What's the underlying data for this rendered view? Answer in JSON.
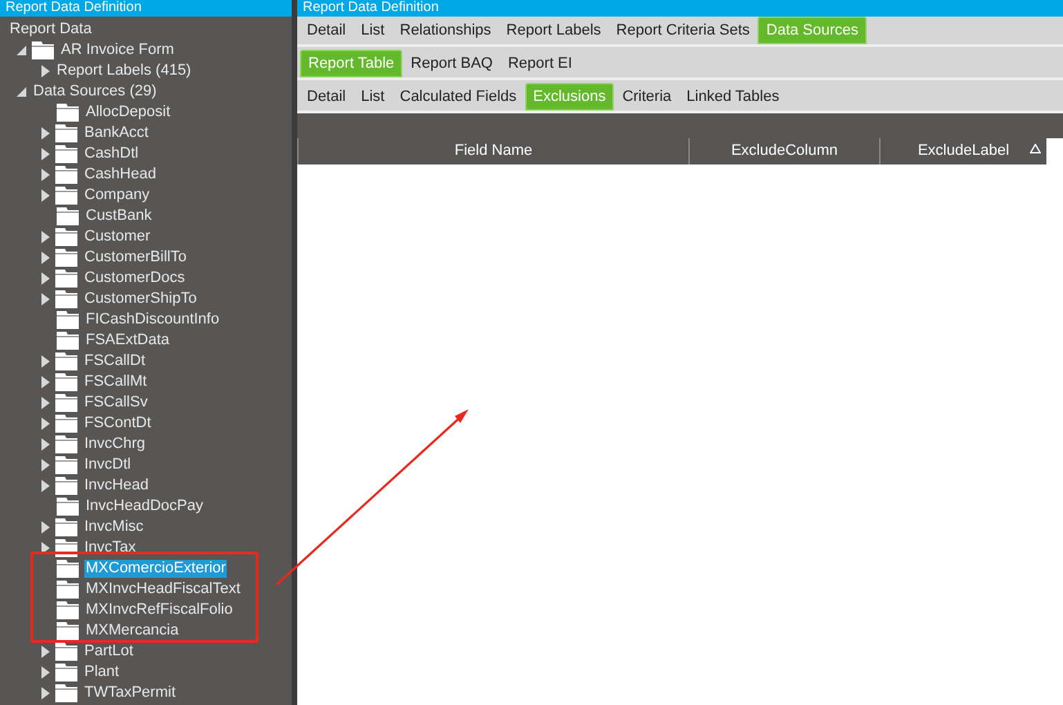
{
  "left_panel": {
    "title": "Report Data Definition"
  },
  "tree": [
    {
      "label": "Report Data",
      "kind": "root",
      "selected": false,
      "children": [
        {
          "label": "AR Invoice Form",
          "kind": "folder",
          "expanded": true,
          "selected": false,
          "children": [
            {
              "label": "Report Labels (415)",
              "kind": "group",
              "expanded": false,
              "selected": false
            }
          ]
        },
        {
          "label": "Data Sources (29)",
          "kind": "group",
          "expanded": true,
          "selected": false,
          "children": [
            {
              "label": "AllocDeposit",
              "kind": "folder",
              "selected": false
            },
            {
              "label": "BankAcct",
              "kind": "folder",
              "expanded": false,
              "selected": false
            },
            {
              "label": "CashDtl",
              "kind": "folder",
              "expanded": false,
              "selected": false
            },
            {
              "label": "CashHead",
              "kind": "folder",
              "expanded": false,
              "selected": false
            },
            {
              "label": "Company",
              "kind": "folder",
              "expanded": false,
              "selected": false
            },
            {
              "label": "CustBank",
              "kind": "folder",
              "selected": false
            },
            {
              "label": "Customer",
              "kind": "folder",
              "expanded": false,
              "selected": false
            },
            {
              "label": "CustomerBillTo",
              "kind": "folder",
              "expanded": false,
              "selected": false
            },
            {
              "label": "CustomerDocs",
              "kind": "folder",
              "expanded": false,
              "selected": false
            },
            {
              "label": "CustomerShipTo",
              "kind": "folder",
              "expanded": false,
              "selected": false
            },
            {
              "label": "FICashDiscountInfo",
              "kind": "folder",
              "selected": false
            },
            {
              "label": "FSAExtData",
              "kind": "folder",
              "selected": false
            },
            {
              "label": "FSCallDt",
              "kind": "folder",
              "expanded": false,
              "selected": false
            },
            {
              "label": "FSCallMt",
              "kind": "folder",
              "expanded": false,
              "selected": false
            },
            {
              "label": "FSCallSv",
              "kind": "folder",
              "expanded": false,
              "selected": false
            },
            {
              "label": "FSContDt",
              "kind": "folder",
              "expanded": false,
              "selected": false
            },
            {
              "label": "InvcChrg",
              "kind": "folder",
              "expanded": false,
              "selected": false
            },
            {
              "label": "InvcDtl",
              "kind": "folder",
              "expanded": false,
              "selected": false
            },
            {
              "label": "InvcHead",
              "kind": "folder",
              "expanded": false,
              "selected": false
            },
            {
              "label": "InvcHeadDocPay",
              "kind": "folder",
              "selected": false
            },
            {
              "label": "InvcMisc",
              "kind": "folder",
              "expanded": false,
              "selected": false
            },
            {
              "label": "InvcTax",
              "kind": "folder",
              "expanded": false,
              "selected": false
            },
            {
              "label": "MXComercioExterior",
              "kind": "folder",
              "selected": true
            },
            {
              "label": "MXInvcHeadFiscalText",
              "kind": "folder",
              "selected": false
            },
            {
              "label": "MXInvcRefFiscalFolio",
              "kind": "folder",
              "selected": false
            },
            {
              "label": "MXMercancia",
              "kind": "folder",
              "selected": false
            },
            {
              "label": "PartLot",
              "kind": "folder",
              "expanded": false,
              "selected": false
            },
            {
              "label": "Plant",
              "kind": "folder",
              "expanded": false,
              "selected": false
            },
            {
              "label": "TWTaxPermit",
              "kind": "folder",
              "expanded": false,
              "selected": false
            }
          ]
        }
      ]
    }
  ],
  "right_panel": {
    "title": "Report Data Definition"
  },
  "tabs": [
    {
      "label": "Detail",
      "selected": false
    },
    {
      "label": "List",
      "selected": false
    },
    {
      "label": "Relationships",
      "selected": false
    },
    {
      "label": "Report Labels",
      "selected": false
    },
    {
      "label": "Report Criteria Sets",
      "selected": false
    },
    {
      "label": "Data Sources",
      "selected": true
    }
  ],
  "subtabs": [
    {
      "label": "Report Table",
      "selected": true
    },
    {
      "label": "Report BAQ",
      "selected": false
    },
    {
      "label": "Report EI",
      "selected": false
    }
  ],
  "table_tabs": [
    {
      "label": "Detail",
      "selected": false
    },
    {
      "label": "List",
      "selected": false
    },
    {
      "label": "Calculated Fields",
      "selected": false
    },
    {
      "label": "Exclusions",
      "selected": true
    },
    {
      "label": "Criteria",
      "selected": false
    },
    {
      "label": "Linked Tables",
      "selected": false
    }
  ],
  "table": {
    "columns": [
      {
        "label": "Field Name",
        "sorted": false
      },
      {
        "label": "ExcludeColumn",
        "sorted": false
      },
      {
        "label": "ExcludeLabel",
        "sorted": true
      }
    ]
  }
}
